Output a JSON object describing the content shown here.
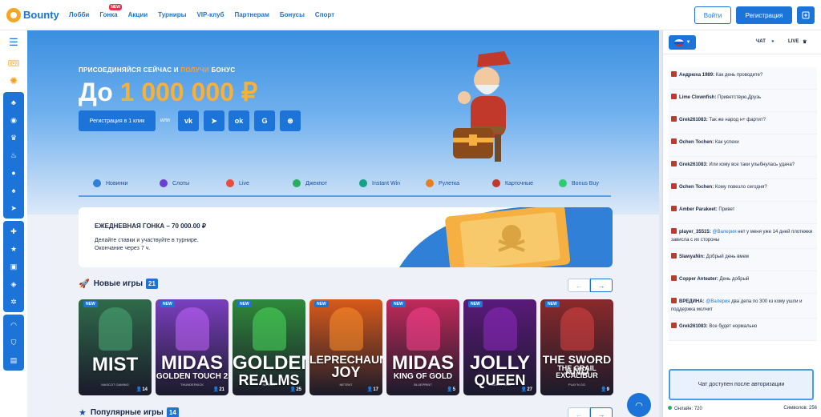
{
  "brand": {
    "name": "Bounty"
  },
  "nav": [
    {
      "label": "Лобби",
      "badge": ""
    },
    {
      "label": "Гонка",
      "badge": "NEW"
    },
    {
      "label": "Акции",
      "badge": ""
    },
    {
      "label": "Турниры",
      "badge": ""
    },
    {
      "label": "VIP-клуб",
      "badge": ""
    },
    {
      "label": "Партнерам",
      "badge": ""
    },
    {
      "label": "Бонусы",
      "badge": ""
    },
    {
      "label": "Спорт",
      "badge": ""
    }
  ],
  "header": {
    "login_label": "Войти",
    "register_label": "Регистрация"
  },
  "hero": {
    "subtitle_a": "ПРИСОЕДИНЯЙСЯ СЕЙЧАС И",
    "subtitle_b": "ПОЛУЧИ",
    "subtitle_c": "БОНУС",
    "amount_prefix": "До",
    "amount": "1 000 000 ₽",
    "register_button": "Регистрация в 1 клик",
    "or": "или",
    "socials": [
      "vk-icon",
      "telegram-icon",
      "odnoklassniki-icon",
      "google-icon",
      "steam-icon"
    ]
  },
  "categories": [
    {
      "label": "Новинки",
      "color": "#2f80d6"
    },
    {
      "label": "Слоты",
      "color": "#6b3fd1"
    },
    {
      "label": "Live",
      "color": "#e74c3c"
    },
    {
      "label": "Джекпот",
      "color": "#27ae60"
    },
    {
      "label": "Instant Win",
      "color": "#16a085"
    },
    {
      "label": "Рулетка",
      "color": "#e67e22"
    },
    {
      "label": "Карточные",
      "color": "#c0392b"
    },
    {
      "label": "Bonus Buy",
      "color": "#2ecc71"
    }
  ],
  "race": {
    "title": "ЕЖЕДНЕВНАЯ ГОНКА – 70 000.00 ₽",
    "desc1": "Делайте ставки и участвуйте в турнире.",
    "desc2": "Окончание через 7 ч."
  },
  "new_games": {
    "title": "Новые игры",
    "count": "21",
    "items": [
      {
        "badge": "NEW",
        "line1": "MIST",
        "line2": "",
        "provider": "MASCOT GAMING",
        "players": "14",
        "color": "#2f6b4a"
      },
      {
        "badge": "NEW",
        "line1": "MIDAS",
        "line2": "GOLDEN TOUCH 2",
        "provider": "THUNDERKICK",
        "players": "21",
        "color": "#7a3fbf"
      },
      {
        "badge": "NEW",
        "line1": "GOLDEN",
        "line2": "REALMS",
        "provider": "NETENT",
        "players": "25",
        "color": "#2f8a3a"
      },
      {
        "badge": "NEW",
        "line1": "LEPRECHAUN",
        "line2": "JOY",
        "provider": "NETENT",
        "players": "17",
        "color": "#d85a1a"
      },
      {
        "badge": "NEW",
        "line1": "MIDAS",
        "line2": "KING OF GOLD",
        "provider": "BLUEPRINT",
        "players": "5",
        "color": "#c02a5a"
      },
      {
        "badge": "NEW",
        "line1": "JOLLY",
        "line2": "QUEEN",
        "provider": "ENDORPHINA",
        "players": "27",
        "color": "#5a1a7a"
      },
      {
        "badge": "NEW",
        "line1": "THE SWORD AND",
        "line2": "THE GRAIL EXCALIBUR",
        "provider": "PLAY'N GO",
        "players": "9",
        "color": "#8a2a2a"
      }
    ]
  },
  "popular_games": {
    "title": "Популярные игры",
    "count": "14"
  },
  "chat": {
    "tab_chat": "ЧАТ",
    "tab_live": "LIVE",
    "messages": [
      {
        "name": "Андрюха 1989:",
        "mention": "",
        "text": "Как день проводите?"
      },
      {
        "name": "Lime Clownfish:",
        "mention": "",
        "text": "Приветствую,Друзь"
      },
      {
        "name": "Grek261083:",
        "mention": "",
        "text": "Так же народ н+ фартит?"
      },
      {
        "name": "Ochen Tochen:",
        "mention": "",
        "text": "Как успехи"
      },
      {
        "name": "Grek261083:",
        "mention": "",
        "text": "Или кому все таки улыбнулась удача?"
      },
      {
        "name": "Ochen Tochen:",
        "mention": "",
        "text": "Кому повезло сегодня?"
      },
      {
        "name": "Amber Parakeet:",
        "mention": "",
        "text": "Привет"
      },
      {
        "name": "player_35515:",
        "mention": "@Валерия",
        "text": "нет у меня уже 14 дней плотежки зависла с их стороны"
      },
      {
        "name": "SlawyaNin:",
        "mention": "",
        "text": "Добрый день вмем"
      },
      {
        "name": "Copper Anteater:",
        "mention": "",
        "text": "День добрый"
      },
      {
        "name": "ВРЕДИНА:",
        "mention": "@Валерия",
        "text": "два депа по 300 кз кому ушли и поддержка молчит"
      },
      {
        "name": "Grek261083:",
        "mention": "",
        "text": "Все будет нормально"
      }
    ],
    "auth_notice": "Чат доступен после авторизации",
    "online": "Онлайн: 720",
    "symbols": "Символов: 256"
  }
}
